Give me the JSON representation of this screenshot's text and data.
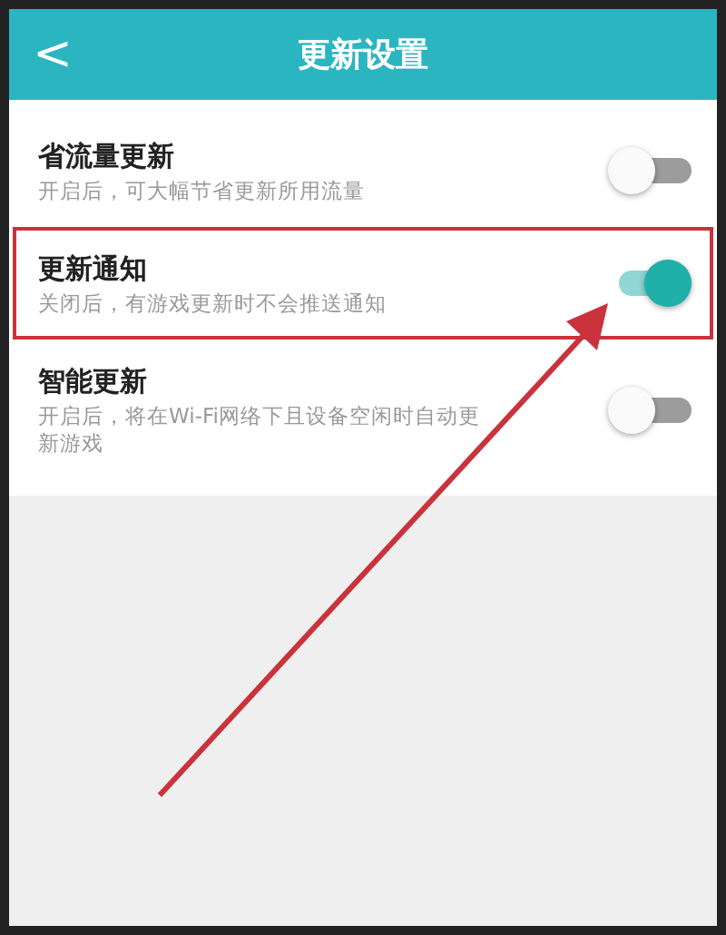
{
  "header": {
    "back_icon": "<",
    "title": "更新设置"
  },
  "settings": [
    {
      "title": "省流量更新",
      "description": "开启后，可大幅节省更新所用流量",
      "on": false,
      "highlighted": false
    },
    {
      "title": "更新通知",
      "description": "关闭后，有游戏更新时不会推送通知",
      "on": true,
      "highlighted": true
    },
    {
      "title": "智能更新",
      "description": "开启后，将在Wi-Fi网络下且设备空闲时自动更新游戏",
      "on": false,
      "highlighted": false
    }
  ]
}
